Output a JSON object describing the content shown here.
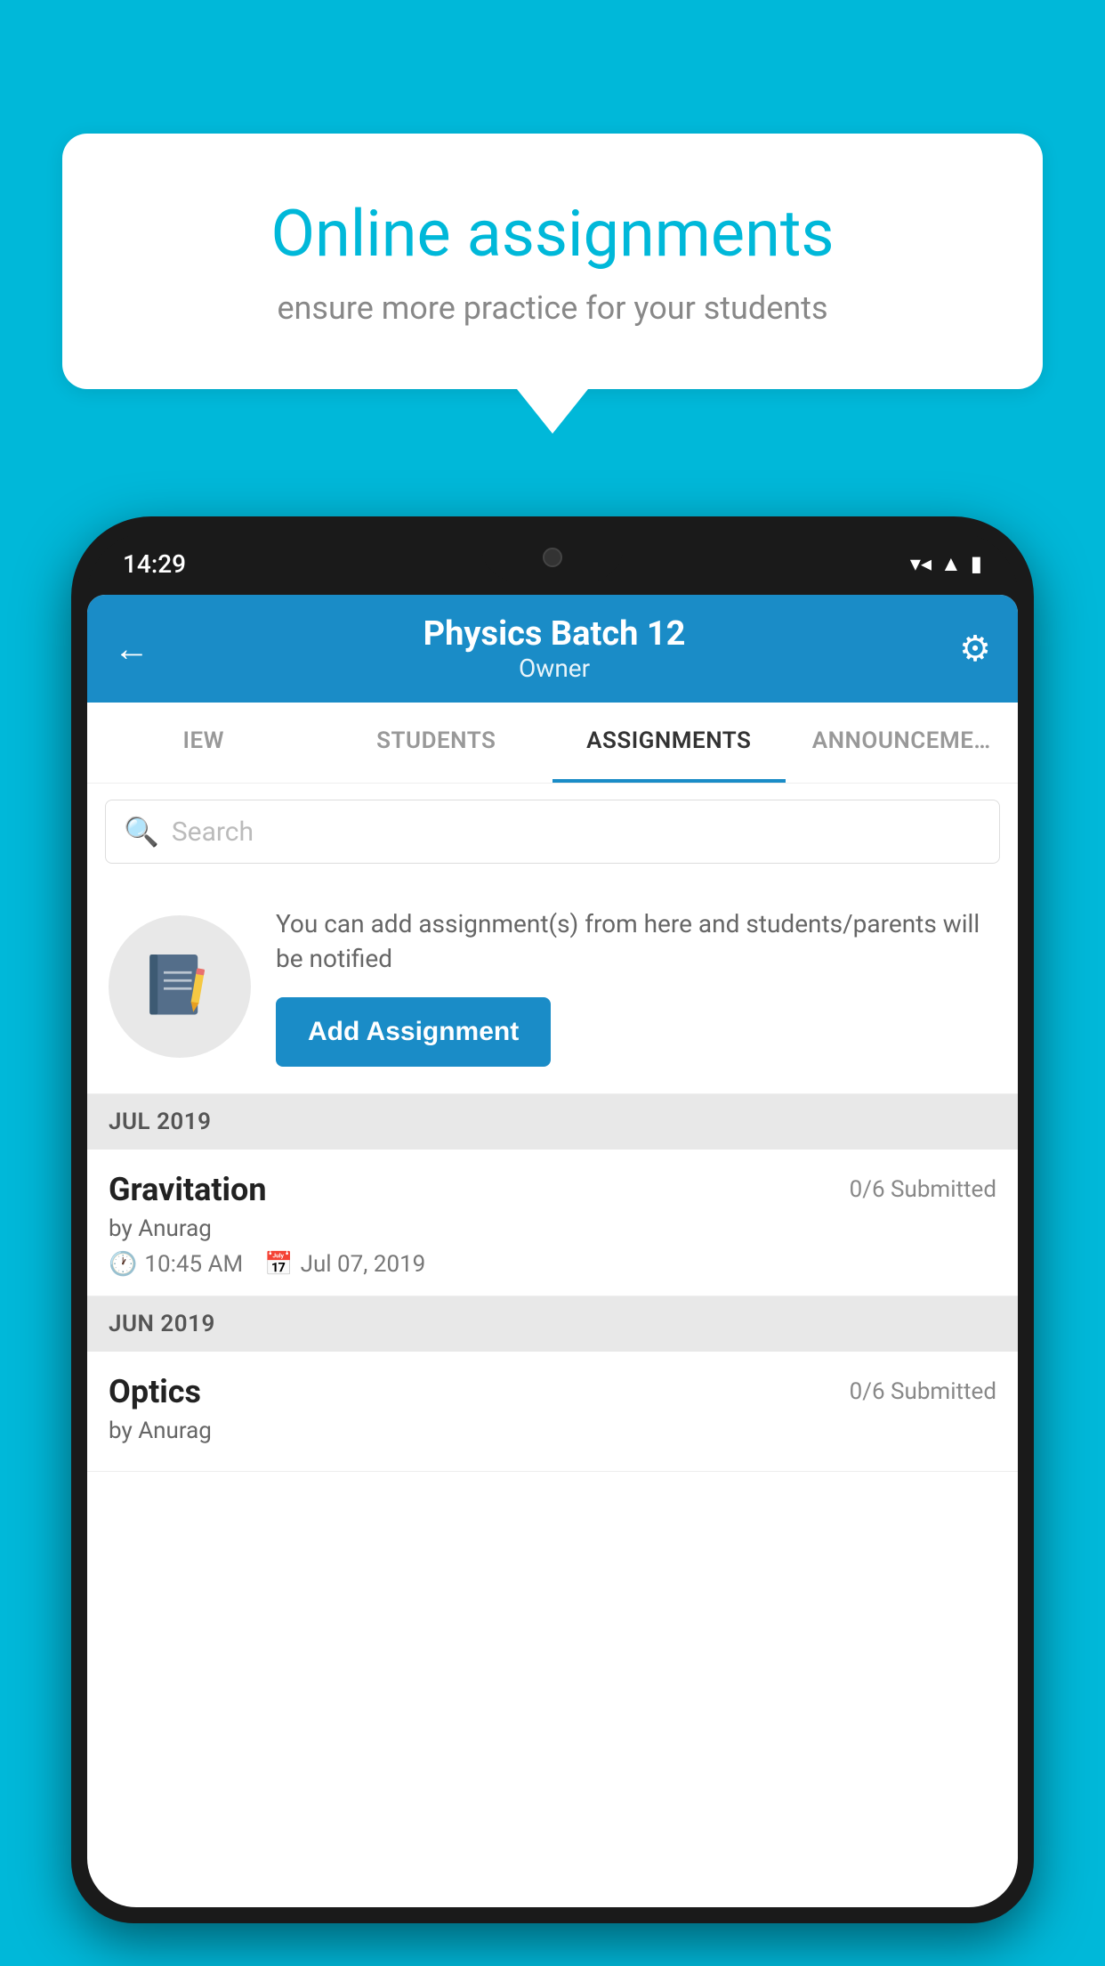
{
  "background": {
    "color": "#00b8d9"
  },
  "speech_bubble": {
    "title": "Online assignments",
    "subtitle": "ensure more practice for your students"
  },
  "status_bar": {
    "time": "14:29",
    "wifi": "▼▲",
    "signal": "▲",
    "battery": "▮"
  },
  "header": {
    "title": "Physics Batch 12",
    "subtitle": "Owner",
    "back_label": "←",
    "gear_label": "⚙"
  },
  "tabs": [
    {
      "id": "iew",
      "label": "IEW",
      "active": false
    },
    {
      "id": "students",
      "label": "STUDENTS",
      "active": false
    },
    {
      "id": "assignments",
      "label": "ASSIGNMENTS",
      "active": true
    },
    {
      "id": "announcements",
      "label": "ANNOUNCEMENTS",
      "active": false
    }
  ],
  "search": {
    "placeholder": "Search"
  },
  "info_block": {
    "text": "You can add assignment(s) from here and students/parents will be notified",
    "add_button_label": "Add Assignment"
  },
  "sections": [
    {
      "header": "JUL 2019",
      "assignments": [
        {
          "title": "Gravitation",
          "status": "0/6 Submitted",
          "by": "by Anurag",
          "time": "10:45 AM",
          "date": "Jul 07, 2019"
        }
      ]
    },
    {
      "header": "JUN 2019",
      "assignments": [
        {
          "title": "Optics",
          "status": "0/6 Submitted",
          "by": "by Anurag",
          "time": "",
          "date": ""
        }
      ]
    }
  ]
}
